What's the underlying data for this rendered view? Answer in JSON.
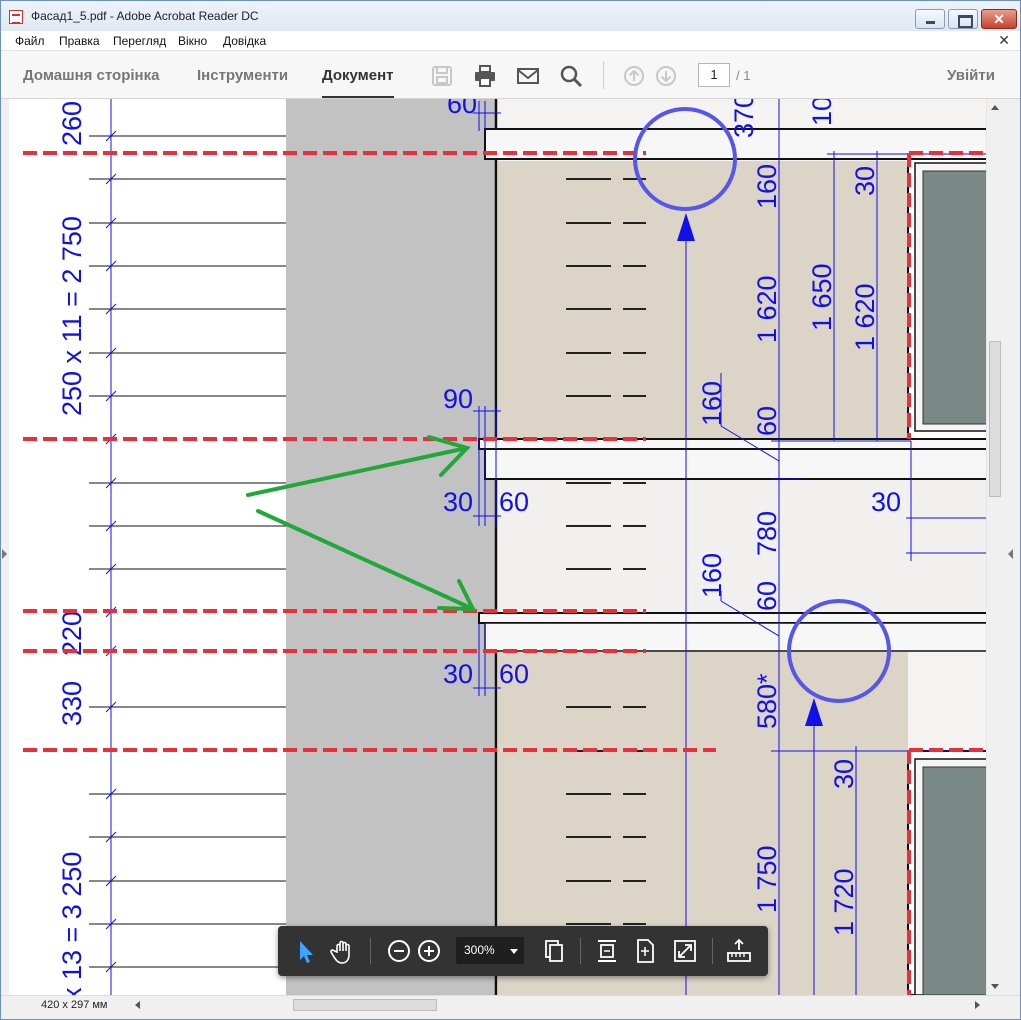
{
  "window": {
    "title": "Фасад1_5.pdf - Adobe Acrobat Reader DC"
  },
  "menu": {
    "items": [
      "Файл",
      "Правка",
      "Перегляд",
      "Вікно",
      "Довідка"
    ]
  },
  "tabs": {
    "home": "Домашня сторінка",
    "tools": "Інструменти",
    "document": "Документ"
  },
  "toolbar": {
    "page_current": "1",
    "page_total": "/ 1",
    "signin": "Увійти"
  },
  "status": {
    "page_size": "420 x 297 мм"
  },
  "zoom": {
    "value": "300%"
  },
  "drawing": {
    "dims_left": [
      "260",
      "250 x 11 = 2 750",
      "220",
      "330",
      "x 13 = 3 250"
    ],
    "dims_mid": [
      "60",
      "90",
      "30",
      "60",
      "30",
      "60"
    ],
    "dims_right": [
      "370",
      "10",
      "160",
      "1 620",
      "1 650",
      "1 620",
      "30",
      "160",
      "60",
      "30",
      "780",
      "160",
      "60",
      "580*",
      "30",
      "1 750",
      "1 720"
    ]
  },
  "colors": {
    "accent_blue": "#1010e8",
    "red_dash": "#e8303c",
    "green_arrow": "#22a83a",
    "circle": "#5656e8"
  }
}
